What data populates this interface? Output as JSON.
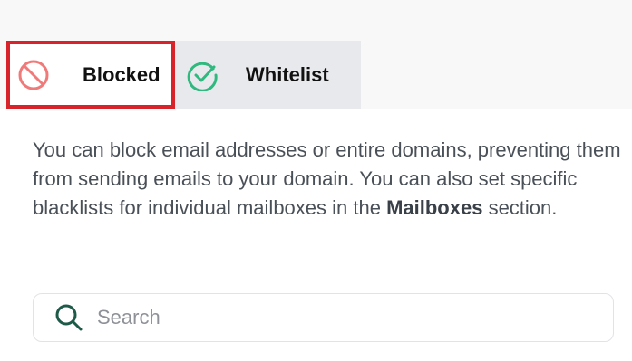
{
  "tabs": {
    "blocked": {
      "label": "Blocked",
      "icon": "block-icon",
      "color": "#f07a7a",
      "active_border": "#d8232a"
    },
    "whitelist": {
      "label": "Whitelist",
      "icon": "check-circle-icon",
      "color": "#2fb97f"
    }
  },
  "description": {
    "before": "You can block email addresses or entire domains, preventing them from sending emails to your domain. You can also set specific blacklists for individual mailboxes in the ",
    "bold": "Mailboxes",
    "after": " section."
  },
  "search": {
    "placeholder": "Search",
    "value": "",
    "icon": "search-icon",
    "icon_color": "#1e5a48"
  }
}
